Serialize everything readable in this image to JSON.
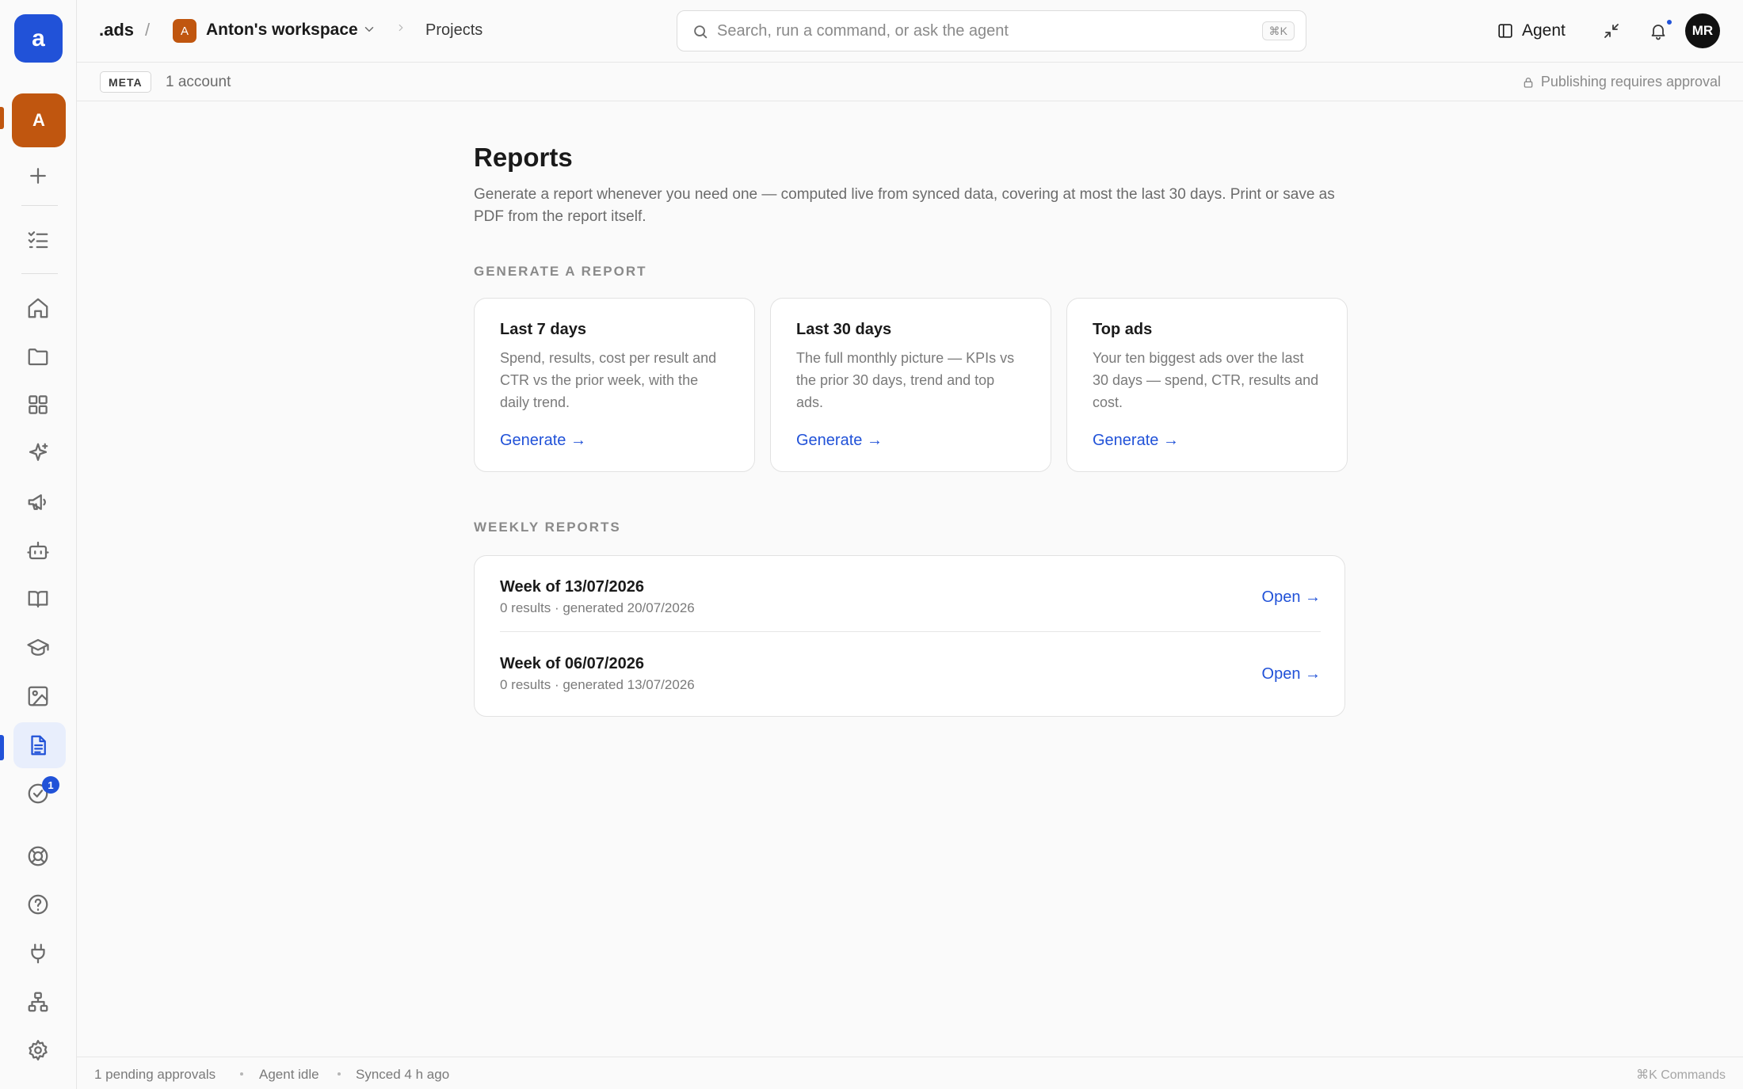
{
  "sidebar": {
    "logo_letter": "a",
    "workspace_initial": "A",
    "approvals_badge": "1",
    "active_item": "reports",
    "icons": [
      "add-icon",
      "checklist-icon",
      "home-icon",
      "folder-icon",
      "grid-icon",
      "sparkle-icon",
      "megaphone-icon",
      "bot-icon",
      "book-icon",
      "graduation-cap-icon",
      "image-icon",
      "document-icon",
      "check-circle-icon",
      "lifebuoy-icon",
      "help-icon",
      "plug-icon",
      "sitemap-icon",
      "gear-icon"
    ]
  },
  "topbar": {
    "brand": ".ads",
    "separator": "/",
    "workspace_initial": "A",
    "workspace_name": "Anton's workspace",
    "breadcrumb": "Projects",
    "search_placeholder": "Search, run a command, or ask the agent",
    "search_shortcut": "⌘K",
    "agent_label": "Agent",
    "user_initials": "MR"
  },
  "subbar": {
    "platform": "META",
    "accounts": "1 account",
    "publishing_note": "Publishing requires approval"
  },
  "page": {
    "title": "Reports",
    "subtitle": "Generate a report whenever you need one — computed live from synced data, covering at most the last 30 days. Print or save as PDF from the report itself.",
    "generate_section": "GENERATE A REPORT",
    "cards": [
      {
        "title": "Last 7 days",
        "description": "Spend, results, cost per result and CTR vs the prior week, with the daily trend.",
        "action": "Generate →"
      },
      {
        "title": "Last 30 days",
        "description": "The full monthly picture — KPIs vs the prior 30 days, trend and top ads.",
        "action": "Generate →"
      },
      {
        "title": "Top ads",
        "description": "Your ten biggest ads over the last 30 days — spend, CTR, results and cost.",
        "action": "Generate →"
      }
    ],
    "weekly_section": "WEEKLY REPORTS",
    "weekly": [
      {
        "title": "Week of 13/07/2026",
        "meta": "0 results · generated 20/07/2026",
        "action": "Open →"
      },
      {
        "title": "Week of 06/07/2026",
        "meta": "0 results · generated 13/07/2026",
        "action": "Open →"
      }
    ]
  },
  "statusbar": {
    "approvals": "1 pending approvals",
    "agent": "Agent idle",
    "synced": "Synced 4 h ago",
    "commands": "⌘K Commands"
  },
  "colors": {
    "accent": "#2152d8",
    "workspace": "#c0560f"
  }
}
